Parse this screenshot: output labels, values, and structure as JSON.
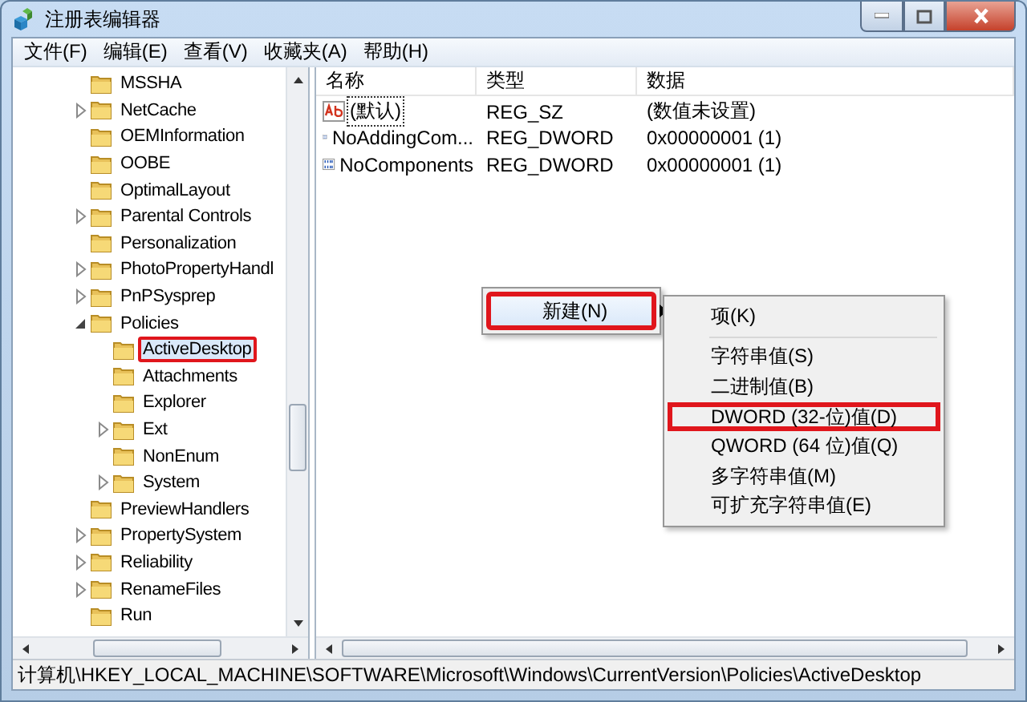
{
  "window": {
    "title": "注册表编辑器"
  },
  "menu": [
    {
      "label": "文件(F)"
    },
    {
      "label": "编辑(E)"
    },
    {
      "label": "查看(V)"
    },
    {
      "label": "收藏夹(A)"
    },
    {
      "label": "帮助(H)"
    }
  ],
  "tree": [
    {
      "label": "MSSHA",
      "kind": "leaf",
      "selected": false,
      "highlighted": false
    },
    {
      "label": "NetCache",
      "kind": "collapsed",
      "selected": false,
      "highlighted": false
    },
    {
      "label": "OEMInformation",
      "kind": "leaf",
      "selected": false,
      "highlighted": false
    },
    {
      "label": "OOBE",
      "kind": "leaf",
      "selected": false,
      "highlighted": false
    },
    {
      "label": "OptimalLayout",
      "kind": "leaf",
      "selected": false,
      "highlighted": false
    },
    {
      "label": "Parental Controls",
      "kind": "collapsed",
      "selected": false,
      "highlighted": false
    },
    {
      "label": "Personalization",
      "kind": "leaf",
      "selected": false,
      "highlighted": false
    },
    {
      "label": "PhotoPropertyHandl",
      "kind": "collapsed",
      "selected": false,
      "highlighted": false
    },
    {
      "label": "PnPSysprep",
      "kind": "collapsed",
      "selected": false,
      "highlighted": false
    },
    {
      "label": "Policies",
      "kind": "expanded",
      "selected": false,
      "highlighted": false,
      "children": [
        {
          "label": "ActiveDesktop",
          "kind": "leaf",
          "selected": true,
          "highlighted": true
        },
        {
          "label": "Attachments",
          "kind": "leaf",
          "selected": false,
          "highlighted": false
        },
        {
          "label": "Explorer",
          "kind": "leaf",
          "selected": false,
          "highlighted": false
        },
        {
          "label": "Ext",
          "kind": "collapsed",
          "selected": false,
          "highlighted": false
        },
        {
          "label": "NonEnum",
          "kind": "leaf",
          "selected": false,
          "highlighted": false
        },
        {
          "label": "System",
          "kind": "collapsed",
          "selected": false,
          "highlighted": false
        }
      ]
    },
    {
      "label": "PreviewHandlers",
      "kind": "leaf",
      "selected": false,
      "highlighted": false
    },
    {
      "label": "PropertySystem",
      "kind": "collapsed",
      "selected": false,
      "highlighted": false
    },
    {
      "label": "Reliability",
      "kind": "collapsed",
      "selected": false,
      "highlighted": false
    },
    {
      "label": "RenameFiles",
      "kind": "collapsed",
      "selected": false,
      "highlighted": false
    },
    {
      "label": "Run",
      "kind": "leaf",
      "selected": false,
      "highlighted": false
    }
  ],
  "values": {
    "columns": [
      "名称",
      "类型",
      "数据"
    ],
    "rows": [
      {
        "kind": "string",
        "name": "(默认)",
        "type": "REG_SZ",
        "data": "(数值未设置)",
        "focused": true
      },
      {
        "kind": "dword",
        "name": "NoAddingCom...",
        "type": "REG_DWORD",
        "data": "0x00000001 (1)",
        "focused": false
      },
      {
        "kind": "dword",
        "name": "NoComponents",
        "type": "REG_DWORD",
        "data": "0x00000001 (1)",
        "focused": false
      }
    ]
  },
  "context_menu": {
    "items": [
      {
        "label": "新建(N)",
        "submenu": true,
        "selected": true,
        "highlighted": true
      }
    ]
  },
  "submenu": {
    "items": [
      {
        "kind": "item",
        "label": "项(K)",
        "highlighted": false
      },
      {
        "kind": "separator"
      },
      {
        "kind": "item",
        "label": "字符串值(S)",
        "highlighted": false
      },
      {
        "kind": "item",
        "label": "二进制值(B)",
        "highlighted": false
      },
      {
        "kind": "item",
        "label": "DWORD (32-位)值(D)",
        "highlighted": true
      },
      {
        "kind": "item",
        "label": "QWORD (64 位)值(Q)",
        "highlighted": false
      },
      {
        "kind": "item",
        "label": "多字符串值(M)",
        "highlighted": false
      },
      {
        "kind": "item",
        "label": "可扩充字符串值(E)",
        "highlighted": false
      }
    ]
  },
  "status_bar": {
    "path": "计算机\\HKEY_LOCAL_MACHINE\\SOFTWARE\\Microsoft\\Windows\\CurrentVersion\\Policies\\ActiveDesktop"
  }
}
